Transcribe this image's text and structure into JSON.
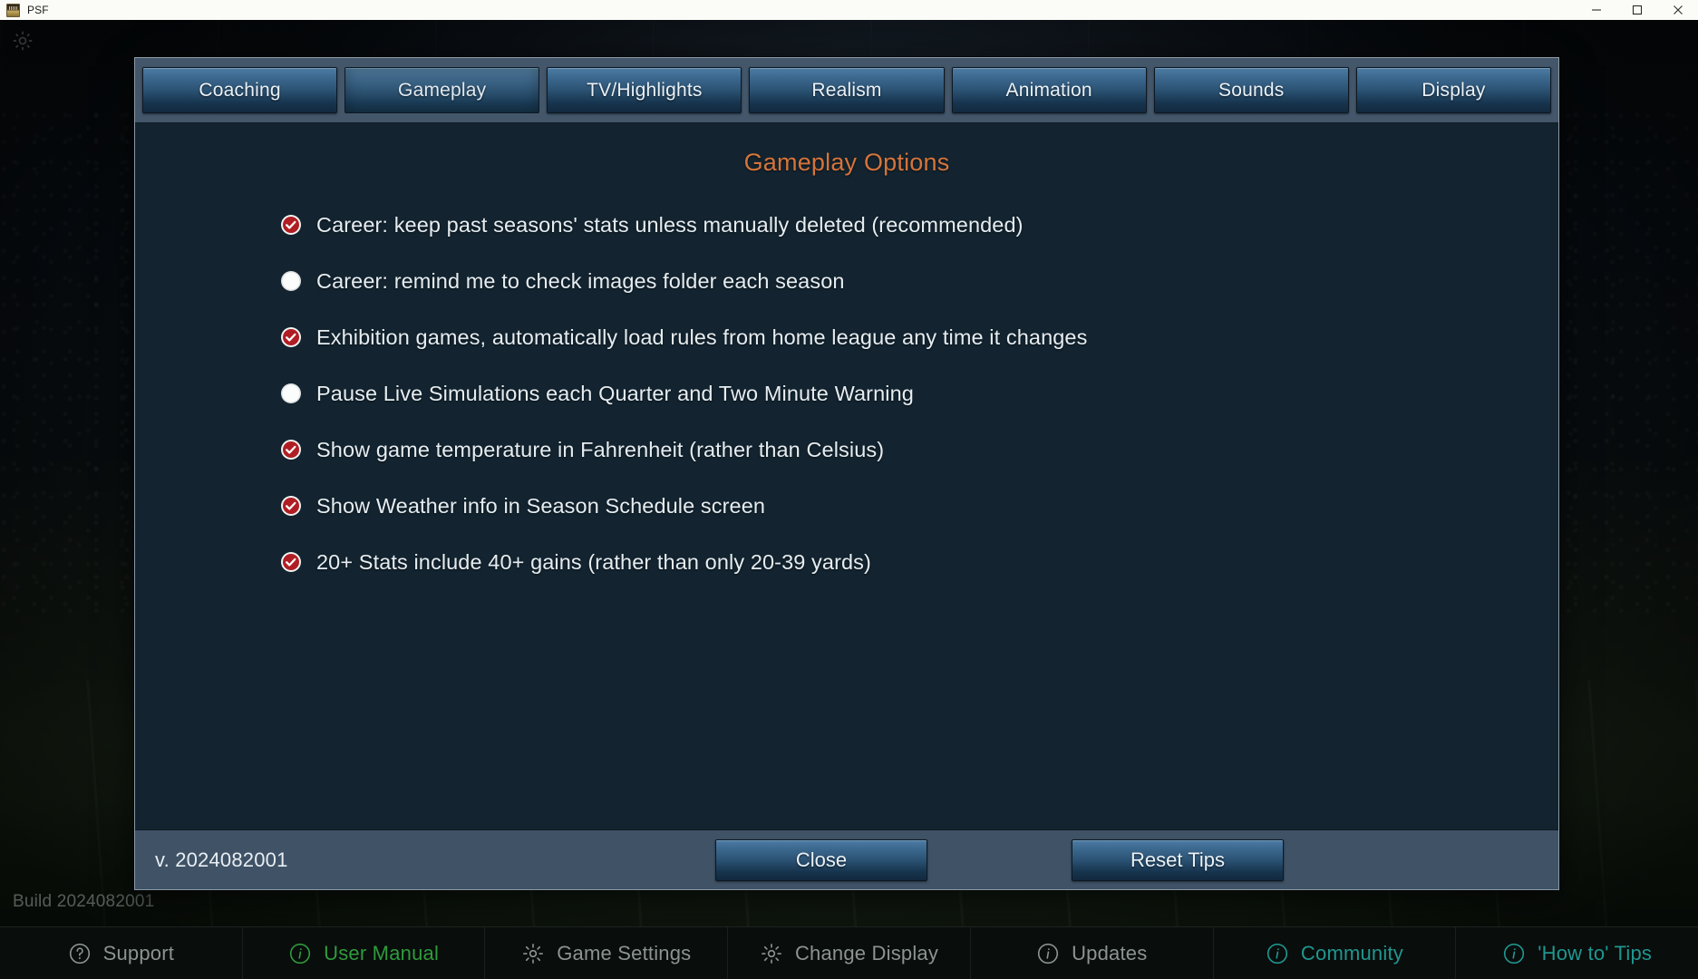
{
  "window": {
    "title": "PSF",
    "controls": [
      {
        "name": "minimize-button",
        "glyph": "minimize"
      },
      {
        "name": "maximize-button",
        "glyph": "maximize"
      },
      {
        "name": "close-button",
        "glyph": "close"
      }
    ]
  },
  "background": {
    "build_text": "Build 2024082001",
    "gear_icon": "gear-icon"
  },
  "dialog": {
    "tabs": [
      {
        "label": "Coaching",
        "active": false
      },
      {
        "label": "Gameplay",
        "active": true
      },
      {
        "label": "TV/Highlights",
        "active": false
      },
      {
        "label": "Realism",
        "active": false
      },
      {
        "label": "Animation",
        "active": false
      },
      {
        "label": "Sounds",
        "active": false
      },
      {
        "label": "Display",
        "active": false
      }
    ],
    "title": "Gameplay Options",
    "options": [
      {
        "label": "Career: keep past seasons' stats unless manually deleted (recommended)",
        "checked": true
      },
      {
        "label": "Career: remind me to check images folder each season",
        "checked": false
      },
      {
        "label": "Exhibition games, automatically load rules from home league any time it changes",
        "checked": true
      },
      {
        "label": "Pause Live Simulations each Quarter and Two Minute Warning",
        "checked": false
      },
      {
        "label": "Show game temperature in Fahrenheit (rather than Celsius)",
        "checked": true
      },
      {
        "label": "Show Weather info in Season Schedule screen",
        "checked": true
      },
      {
        "label": "20+ Stats include 40+ gains (rather than only 20-39 yards)",
        "checked": true
      }
    ],
    "footer": {
      "version": "v. 2024082001",
      "close_label": "Close",
      "reset_tips_label": "Reset Tips"
    }
  },
  "bottombar": {
    "items": [
      {
        "label": "Support",
        "icon": "question-circle-icon",
        "color": "#8b9490"
      },
      {
        "label": "User Manual",
        "icon": "info-circle-icon",
        "color": "#2f9b3c"
      },
      {
        "label": "Game Settings",
        "icon": "gear-icon",
        "color": "#8b9490"
      },
      {
        "label": "Change Display",
        "icon": "gear-icon",
        "color": "#8b9490"
      },
      {
        "label": "Updates",
        "icon": "info-circle-icon",
        "color": "#8b9490"
      },
      {
        "label": "Community",
        "icon": "info-circle-icon",
        "color": "#1f9790"
      },
      {
        "label": "'How to' Tips",
        "icon": "info-circle-icon",
        "color": "#1f9790"
      }
    ]
  },
  "colors": {
    "accent_title": "#d5743b",
    "checked_red": "#b01e24",
    "dialog_body": "#132430",
    "tab_strip": "#43566a",
    "footer_bar": "#3f5266"
  }
}
